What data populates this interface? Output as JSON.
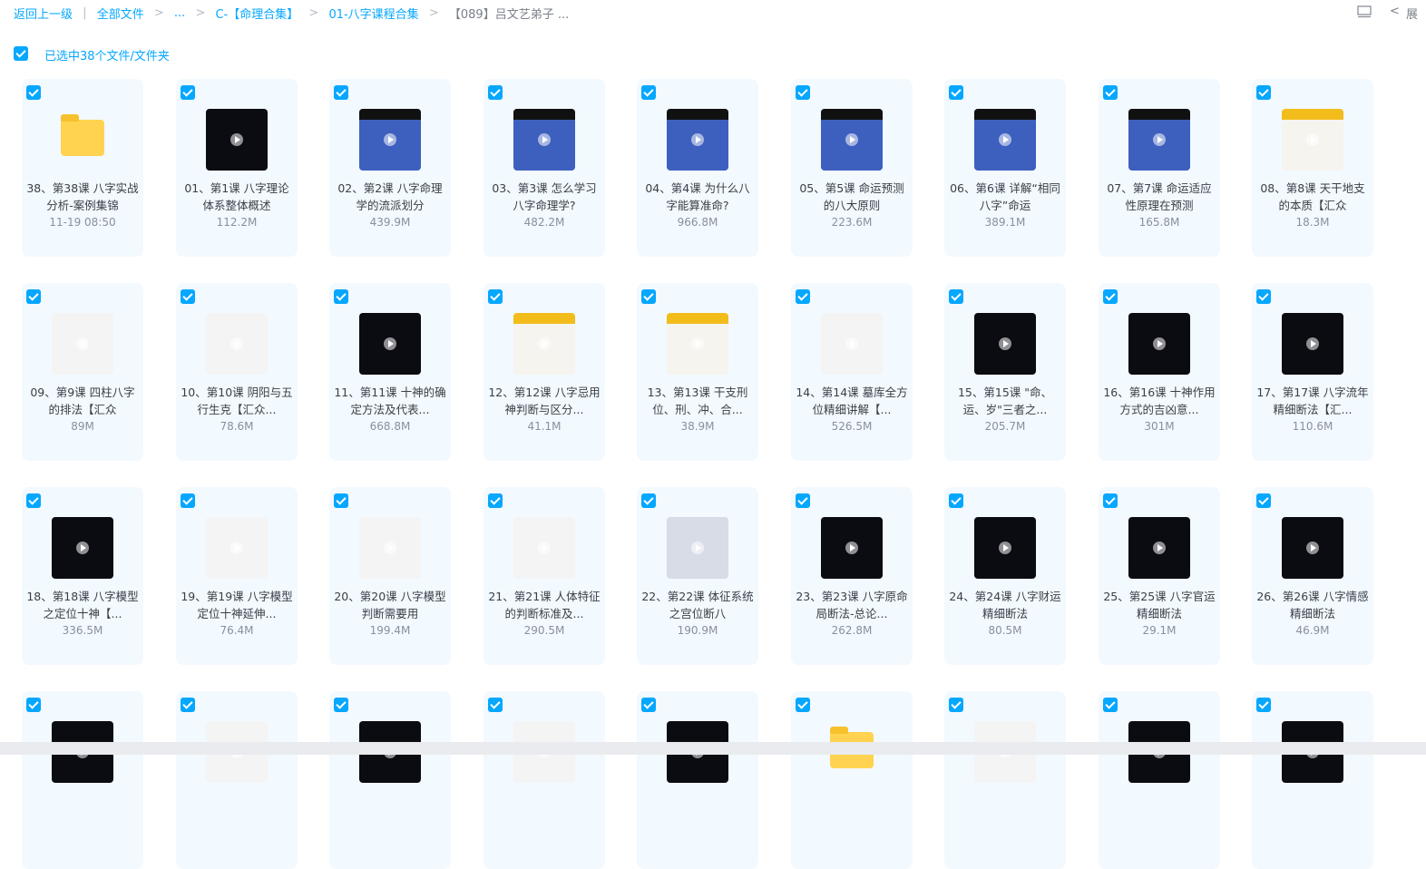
{
  "breadcrumb": {
    "back": "返回上一级",
    "all_files": "全部文件",
    "ellipsis": "...",
    "level1": "C-【命理合集】",
    "level2": "01-八字课程合集",
    "current": "【089】吕文艺弟子 ..."
  },
  "header": {
    "collapse_label": "展"
  },
  "selection": {
    "text": "已选中38个文件/文件夹"
  },
  "files": [
    {
      "name": "38、第38课 八字实战分析-案例集锦",
      "meta": "11-19 08:50",
      "thumb": "folder",
      "icon": "folder-icon"
    },
    {
      "name": "01、第1课 八字理论体系整体概述",
      "meta": "112.2M",
      "thumb": "dark",
      "icon": "video-thumbnail"
    },
    {
      "name": "02、第2课 八字命理学的流派划分",
      "meta": "439.9M",
      "thumb": "blue",
      "icon": "video-thumbnail"
    },
    {
      "name": "03、第3课 怎么学习八字命理学?",
      "meta": "482.2M",
      "thumb": "blue",
      "icon": "video-thumbnail"
    },
    {
      "name": "04、第4课 为什么八字能算准命?",
      "meta": "966.8M",
      "thumb": "blue",
      "icon": "video-thumbnail"
    },
    {
      "name": "05、第5课 命运预测的八大原则",
      "meta": "223.6M",
      "thumb": "blue",
      "icon": "video-thumbnail"
    },
    {
      "name": "06、第6课 详解“相同八字”命运",
      "meta": "389.1M",
      "thumb": "blue",
      "icon": "video-thumbnail"
    },
    {
      "name": "07、第7课 命运适应性原理在预测",
      "meta": "165.8M",
      "thumb": "blue",
      "icon": "video-thumbnail"
    },
    {
      "name": "08、第8课 天干地支的本质【汇众",
      "meta": "18.3M",
      "thumb": "yellow",
      "icon": "video-thumbnail"
    },
    {
      "name": "09、第9课 四柱八字的排法【汇众",
      "meta": "89M",
      "thumb": "white",
      "icon": "video-thumbnail"
    },
    {
      "name": "10、第10课 阴阳与五行生克【汇众...",
      "meta": "78.6M",
      "thumb": "white",
      "icon": "video-thumbnail"
    },
    {
      "name": "11、第11课 十神的确定方法及代表...",
      "meta": "668.8M",
      "thumb": "dark",
      "icon": "video-thumbnail"
    },
    {
      "name": "12、第12课 八字忌用神判断与区分...",
      "meta": "41.1M",
      "thumb": "yellow",
      "icon": "video-thumbnail"
    },
    {
      "name": "13、第13课 干支刑位、刑、冲、合...",
      "meta": "38.9M",
      "thumb": "yellow",
      "icon": "video-thumbnail"
    },
    {
      "name": "14、第14课 墓库全方位精细讲解【...",
      "meta": "526.5M",
      "thumb": "white",
      "icon": "video-thumbnail"
    },
    {
      "name": "15、第15课 \"命、运、岁\"三者之...",
      "meta": "205.7M",
      "thumb": "dark",
      "icon": "video-thumbnail"
    },
    {
      "name": "16、第16课 十神作用方式的吉凶意...",
      "meta": "301M",
      "thumb": "dark",
      "icon": "video-thumbnail"
    },
    {
      "name": "17、第17课 八字流年精细断法【汇...",
      "meta": "110.6M",
      "thumb": "dark",
      "icon": "video-thumbnail"
    },
    {
      "name": "18、第18课 八字模型之定位十神【...",
      "meta": "336.5M",
      "thumb": "dark",
      "icon": "video-thumbnail"
    },
    {
      "name": "19、第19课 八字模型定位十神延伸...",
      "meta": "76.4M",
      "thumb": "white",
      "icon": "video-thumbnail"
    },
    {
      "name": "20、第20课 八字模型判断需要用",
      "meta": "199.4M",
      "thumb": "white",
      "icon": "video-thumbnail"
    },
    {
      "name": "21、第21课 人体特征的判断标准及...",
      "meta": "290.5M",
      "thumb": "white",
      "icon": "video-thumbnail"
    },
    {
      "name": "22、第22课 体征系统之宫位断八",
      "meta": "190.9M",
      "thumb": "photo",
      "icon": "video-thumbnail"
    },
    {
      "name": "23、第23课 八字原命局断法-总论...",
      "meta": "262.8M",
      "thumb": "dark",
      "icon": "video-thumbnail"
    },
    {
      "name": "24、第24课 八字财运精细断法",
      "meta": "80.5M",
      "thumb": "dark",
      "icon": "video-thumbnail"
    },
    {
      "name": "25、第25课 八字官运精细断法",
      "meta": "29.1M",
      "thumb": "dark",
      "icon": "video-thumbnail"
    },
    {
      "name": "26、第26课 八字情感精细断法",
      "meta": "46.9M",
      "thumb": "dark",
      "icon": "video-thumbnail"
    },
    {
      "name": "",
      "meta": "",
      "thumb": "dark",
      "icon": "video-thumbnail"
    },
    {
      "name": "",
      "meta": "",
      "thumb": "white",
      "icon": "video-thumbnail"
    },
    {
      "name": "",
      "meta": "",
      "thumb": "dark",
      "icon": "video-thumbnail"
    },
    {
      "name": "",
      "meta": "",
      "thumb": "white",
      "icon": "video-thumbnail"
    },
    {
      "name": "",
      "meta": "",
      "thumb": "dark",
      "icon": "video-thumbnail"
    },
    {
      "name": "",
      "meta": "",
      "thumb": "folder",
      "icon": "file-icon"
    },
    {
      "name": "",
      "meta": "",
      "thumb": "white",
      "icon": "video-thumbnail"
    },
    {
      "name": "",
      "meta": "",
      "thumb": "dark",
      "icon": "video-thumbnail"
    },
    {
      "name": "",
      "meta": "",
      "thumb": "dark",
      "icon": "video-thumbnail"
    }
  ],
  "colors": {
    "accent": "#06a7ff",
    "card_bg": "#f2f9ff",
    "folder": "#ffd34f"
  }
}
